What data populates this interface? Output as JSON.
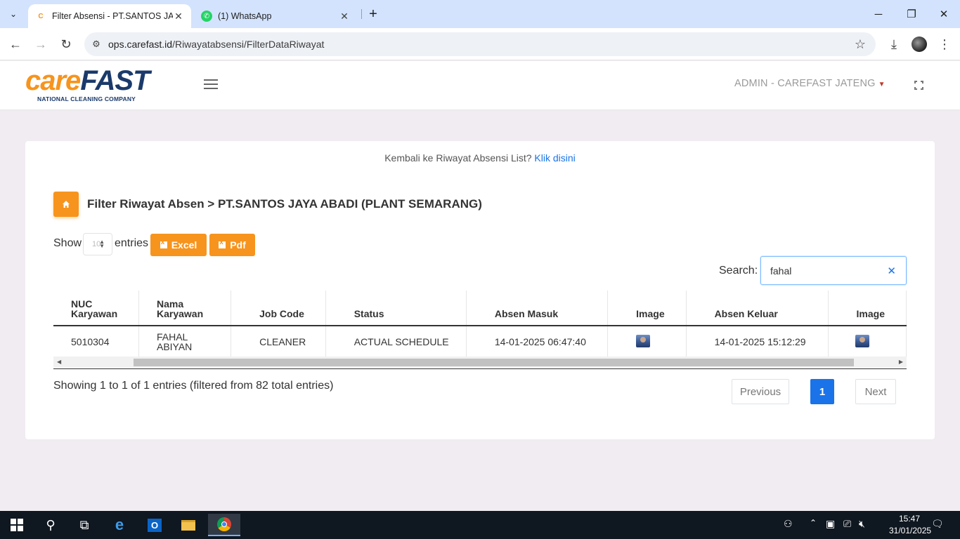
{
  "browser": {
    "tabs": [
      {
        "title": "Filter Absensi - PT.SANTOS JAYA",
        "active": true
      },
      {
        "title": "(1) WhatsApp",
        "active": false
      }
    ],
    "url_host": "ops.carefast.id",
    "url_path": "/Riwayatabsensi/FilterDataRiwayat"
  },
  "header": {
    "logo_care": "care",
    "logo_fast": "FAST",
    "logo_tagline": "NATIONAL CLEANING COMPANY",
    "user": "ADMIN - CAREFAST JATENG"
  },
  "content": {
    "back_text": "Kembali ke Riwayat Absensi List?",
    "back_link": "Klik disini",
    "title": "Filter Riwayat Absen > PT.SANTOS JAYA ABADI (PLANT SEMARANG)",
    "show_label": "Show",
    "show_value": "10",
    "entries_label": "entries",
    "excel_label": "Excel",
    "pdf_label": "Pdf",
    "search_label": "Search:",
    "search_value": "fahal",
    "info_text": "Showing 1 to 1 of 1 entries (filtered from 82 total entries)",
    "pager": {
      "prev": "Previous",
      "current": "1",
      "next": "Next"
    }
  },
  "table": {
    "headers": {
      "nuc_1": "NUC",
      "nuc_2": "Karyawan",
      "nama_1": "Nama",
      "nama_2": "Karyawan",
      "job": "Job Code",
      "status": "Status",
      "masuk": "Absen Masuk",
      "image": "Image",
      "keluar": "Absen Keluar",
      "image2": "Image"
    },
    "rows": [
      {
        "nuc": "5010304",
        "nama_1": "FAHAL",
        "nama_2": "ABIYAN",
        "job": "CLEANER",
        "status": "ACTUAL SCHEDULE",
        "masuk": "14-01-2025 06:47:40",
        "keluar": "14-01-2025 15:12:29"
      }
    ]
  },
  "taskbar": {
    "time": "15:47",
    "date": "31/01/2025"
  }
}
